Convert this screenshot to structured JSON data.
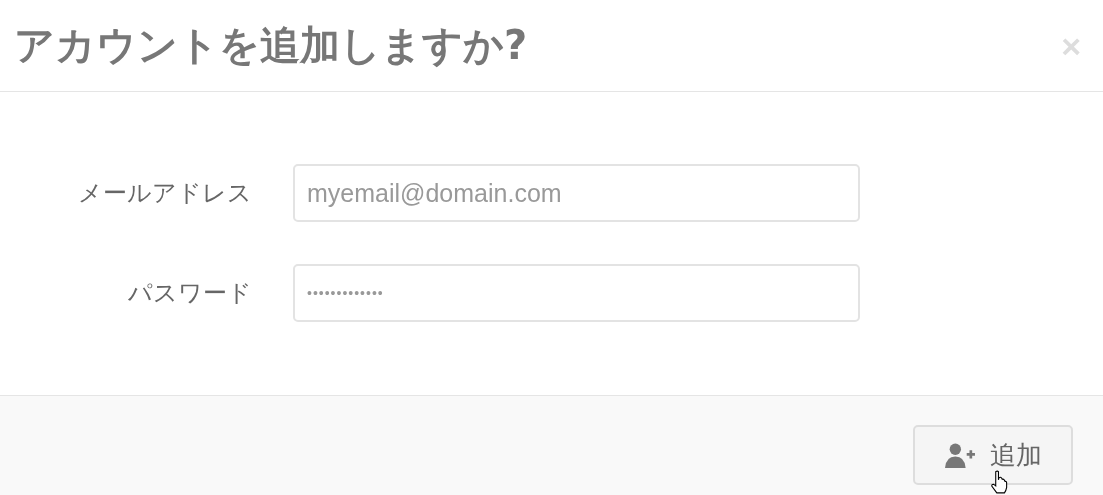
{
  "dialog": {
    "title": "アカウントを追加しますか?",
    "close": "×"
  },
  "fields": [
    {
      "label": "メールアドレス",
      "placeholder": "myemail@domain.com",
      "kind": "text"
    },
    {
      "label": "パスワード",
      "value": "•••••••••••••",
      "kind": "password"
    }
  ],
  "buttons": [
    {
      "label": "追加"
    }
  ]
}
